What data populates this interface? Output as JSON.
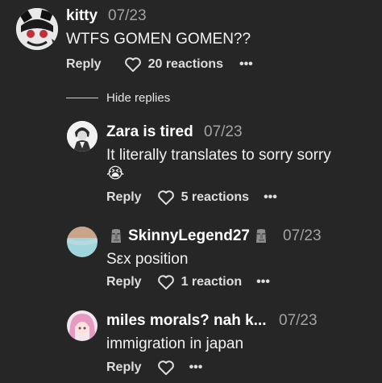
{
  "comments": [
    {
      "username": "kitty",
      "time": "07/23",
      "text": "WTFS GOMEN GOMEN??",
      "reply_label": "Reply",
      "reactions": "20 reactions",
      "more": "•••"
    }
  ],
  "replies_toggle": {
    "label": "Hide replies"
  },
  "replies": [
    {
      "username": "Zara is tired",
      "time": "07/23",
      "text_line1": "It literally translates to sorry sorry",
      "text_line2": "😭",
      "reply_label": "Reply",
      "reactions": "5 reactions",
      "more": "•••"
    },
    {
      "username": "SkinnyLegend27",
      "time": "07/23",
      "text": "Sεx position",
      "reply_label": "Reply",
      "reactions": "1 reaction",
      "more": "•••"
    },
    {
      "username": "miles morals? nah k...",
      "time": "07/23",
      "text": "immigration in japan",
      "reply_label": "Reply",
      "reactions": "",
      "more": "•••"
    }
  ],
  "colors": {
    "background": "#262626",
    "secondary_text": "#a3a3a3"
  },
  "icons": {
    "heart": "heart-outline-icon",
    "more": "more-dots-icon",
    "moai": "moai-emoji-icon"
  }
}
